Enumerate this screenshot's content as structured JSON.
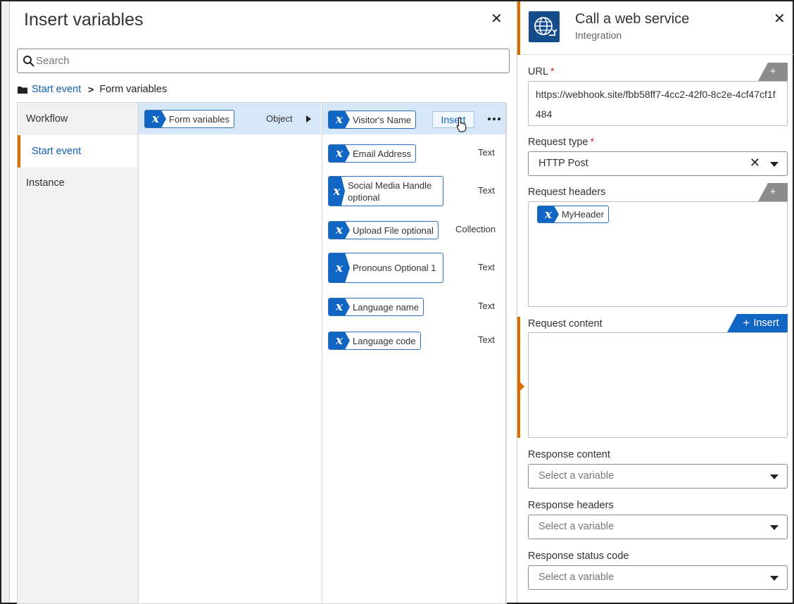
{
  "insert_panel": {
    "title": "Insert variables",
    "search_placeholder": "Search",
    "breadcrumb": {
      "root": "Start event",
      "current": "Form variables"
    },
    "nav": [
      "Workflow",
      "Start event",
      "Instance"
    ],
    "middle_item": {
      "label": "Form variables",
      "type": "Object"
    },
    "insert_label": "Insert",
    "variables": [
      {
        "label": "Visitor's Name",
        "type": ""
      },
      {
        "label": "Email Address",
        "type": "Text"
      },
      {
        "label": "Social Media Handle optional",
        "type": "Text"
      },
      {
        "label": "Upload File optional",
        "type": "Collection"
      },
      {
        "label": "Pronouns Optional 1",
        "type": "Text"
      },
      {
        "label": "Language name",
        "type": "Text"
      },
      {
        "label": "Language code",
        "type": "Text"
      }
    ]
  },
  "web_service": {
    "title": "Call a web service",
    "subtitle": "Integration",
    "url_label": "URL",
    "url_value": "https://webhook.site/fbb58ff7-4cc2-42f0-8c2e-4cf47cf1f484",
    "request_type_label": "Request type",
    "request_type_value": "HTTP Post",
    "request_headers_label": "Request headers",
    "header_chip": "MyHeader",
    "request_content_label": "Request content",
    "insert_button": "Insert",
    "response_content_label": "Response content",
    "response_headers_label": "Response headers",
    "response_status_label": "Response status code",
    "select_placeholder": "Select a variable"
  },
  "colors": {
    "accent_blue": "#1166c4",
    "accent_orange": "#e06c00",
    "selection": "#d6e8f8"
  },
  "icons": [
    "close-icon",
    "search-icon",
    "folder-icon",
    "chevron-right-icon",
    "variable-icon",
    "globe-icon",
    "plus-icon",
    "caret-down-icon",
    "more-icon"
  ]
}
